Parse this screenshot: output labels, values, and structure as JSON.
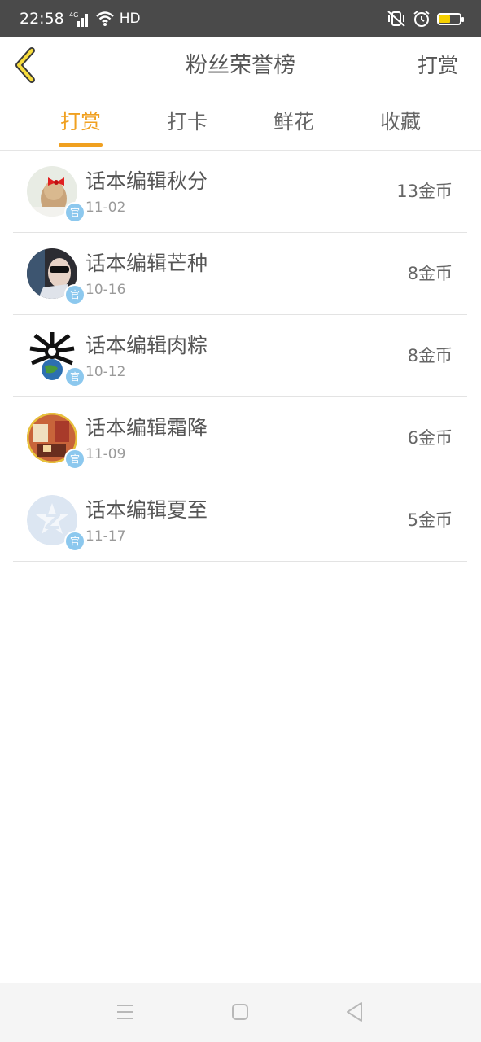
{
  "status_bar": {
    "time": "22:58",
    "network": "4G",
    "hd_label": "HD",
    "battery_level": 0.55,
    "battery_color": "#f5d000"
  },
  "header": {
    "title": "粉丝荣誉榜",
    "right_action": "打赏",
    "back_icon": "chevron-left-icon"
  },
  "tabs": [
    {
      "label": "打赏",
      "active": true
    },
    {
      "label": "打卡",
      "active": false
    },
    {
      "label": "鲜花",
      "active": false
    },
    {
      "label": "收藏",
      "active": false
    }
  ],
  "accent_color": "#f0a020",
  "badge_label": "官",
  "list": [
    {
      "name": "话本编辑秋分",
      "date": "11-02",
      "amount": "13金币",
      "avatar": "girl-red-bow"
    },
    {
      "name": "话本编辑芒种",
      "date": "10-16",
      "amount": "8金币",
      "avatar": "sunglasses-person"
    },
    {
      "name": "话本编辑肉粽",
      "date": "10-12",
      "amount": "8金币",
      "avatar": "spider-globe"
    },
    {
      "name": "话本编辑霜降",
      "date": "11-09",
      "amount": "6金币",
      "avatar": "illustration-warm"
    },
    {
      "name": "话本编辑夏至",
      "date": "11-17",
      "amount": "5金币",
      "avatar": "default-z-logo"
    }
  ],
  "nav_bar": {
    "menu_icon": "menu-icon",
    "home_icon": "home-square-icon",
    "back_icon": "back-triangle-icon"
  }
}
